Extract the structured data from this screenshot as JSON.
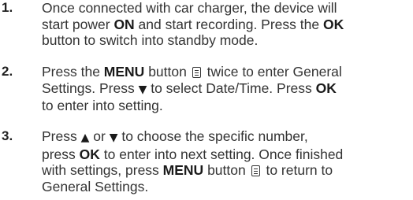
{
  "steps": [
    {
      "number": "1.",
      "lines": [
        [
          "Once connected with car charger, the device will"
        ],
        [
          "start power ",
          {
            "b": "ON"
          },
          " and start recording. Press the ",
          {
            "b": "OK"
          }
        ],
        [
          "button to switch into standby mode."
        ]
      ]
    },
    {
      "number": "2.",
      "lines": [
        [
          "Press the ",
          {
            "b": "MENU"
          },
          " button ",
          {
            "icon": "menu-icon"
          },
          " twice to enter General"
        ],
        [
          "Settings. Press ",
          {
            "glyph": "▼"
          },
          " to select Date/Time. Press ",
          {
            "b": "OK"
          }
        ],
        [
          "to enter into setting."
        ]
      ]
    },
    {
      "number": "3.",
      "lines": [
        [
          "Press ",
          {
            "glyph": "▲"
          },
          " or ",
          {
            "glyph": "▼"
          },
          " to choose the specific number,"
        ],
        [
          "press ",
          {
            "b": "OK"
          },
          " to enter into next setting. Once finished"
        ],
        [
          "with settings, press ",
          {
            "b": "MENU"
          },
          " button ",
          {
            "icon": "menu-icon"
          },
          " to return to"
        ],
        [
          "General Settings."
        ]
      ]
    }
  ]
}
